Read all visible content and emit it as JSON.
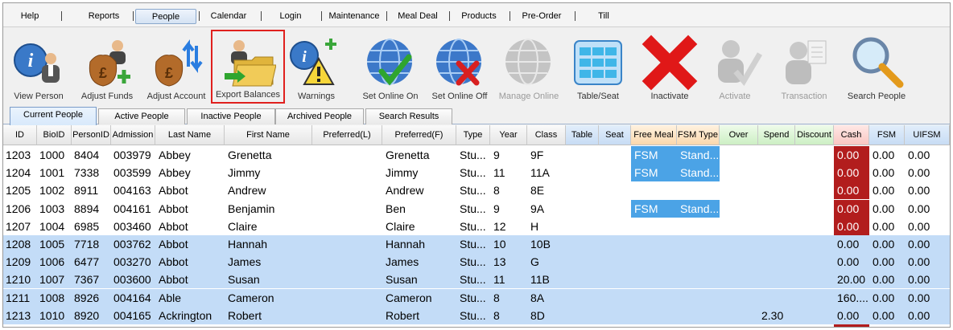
{
  "menu": [
    {
      "label": "Help"
    },
    {
      "label": "Reports"
    },
    {
      "label": "People",
      "active": true
    },
    {
      "label": "Calendar"
    },
    {
      "label": "Login"
    },
    {
      "label": "Maintenance"
    },
    {
      "label": "Meal Deal"
    },
    {
      "label": "Products"
    },
    {
      "label": "Pre-Order"
    },
    {
      "label": "Till"
    }
  ],
  "toolbar": [
    {
      "label": "View Person",
      "icon": "view-person-icon"
    },
    {
      "label": "Adjust Funds",
      "icon": "adjust-funds-icon"
    },
    {
      "label": "Adjust Account",
      "icon": "adjust-account-icon"
    },
    {
      "label": "Export Balances",
      "icon": "export-balances-icon",
      "selected": true
    },
    {
      "label": "Warnings",
      "icon": "warnings-icon"
    },
    {
      "label": "Set Online On",
      "icon": "set-online-on-icon"
    },
    {
      "label": "Set Online Off",
      "icon": "set-online-off-icon"
    },
    {
      "label": "Manage Online",
      "icon": "manage-online-icon",
      "disabled": true
    },
    {
      "label": "Table/Seat",
      "icon": "table-seat-icon"
    },
    {
      "label": "Inactivate",
      "icon": "inactivate-icon"
    },
    {
      "label": "Activate",
      "icon": "activate-icon",
      "disabled": true
    },
    {
      "label": "Transaction",
      "icon": "transaction-icon",
      "disabled": true
    },
    {
      "label": "Search People",
      "icon": "search-people-icon"
    }
  ],
  "tabs": [
    {
      "label": "Current People",
      "active": true
    },
    {
      "label": "Active People"
    },
    {
      "label": "Inactive People"
    },
    {
      "label": "Archived People"
    },
    {
      "label": "Search Results"
    }
  ],
  "columns": [
    "ID",
    "BioID",
    "PersonID",
    "Admission",
    "Last Name",
    "First Name",
    "Preferred(L)",
    "Preferred(F)",
    "Type",
    "Year",
    "Class",
    "Table",
    "Seat",
    "Free Meal",
    "FSM Type",
    "Over",
    "Spend",
    "Discount",
    "Cash",
    "FSM",
    "UIFSM"
  ],
  "rows": [
    [
      "1203",
      "1000",
      "8404",
      "003979",
      "Abbey",
      "Grenetta",
      "",
      "Grenetta",
      "Stu...",
      "9",
      "9F",
      "",
      "",
      "FSM",
      "Stand...",
      "",
      "",
      "",
      "0.00",
      "0.00",
      "0.00"
    ],
    [
      "1204",
      "1001",
      "7338",
      "003599",
      "Abbey",
      "Jimmy",
      "",
      "Jimmy",
      "Stu...",
      "11",
      "11A",
      "",
      "",
      "FSM",
      "Stand...",
      "",
      "",
      "",
      "0.00",
      "0.00",
      "0.00"
    ],
    [
      "1205",
      "1002",
      "8911",
      "004163",
      "Abbot",
      "Andrew",
      "",
      "Andrew",
      "Stu...",
      "8",
      "8E",
      "",
      "",
      "",
      "",
      "",
      "",
      "",
      "0.00",
      "0.00",
      "0.00"
    ],
    [
      "1206",
      "1003",
      "8894",
      "004161",
      "Abbot",
      "Benjamin",
      "",
      "Ben",
      "Stu...",
      "9",
      "9A",
      "",
      "",
      "FSM",
      "Stand...",
      "",
      "",
      "",
      "0.00",
      "0.00",
      "0.00"
    ],
    [
      "1207",
      "1004",
      "6985",
      "003460",
      "Abbot",
      "Claire",
      "",
      "Claire",
      "Stu...",
      "12",
      "H",
      "",
      "",
      "",
      "",
      "",
      "",
      "",
      "0.00",
      "0.00",
      "0.00"
    ],
    [
      "1208",
      "1005",
      "7718",
      "003762",
      "Abbot",
      "Hannah",
      "",
      "Hannah",
      "Stu...",
      "10",
      "10B",
      "",
      "",
      "",
      "",
      "",
      "",
      "",
      "0.00",
      "0.00",
      "0.00"
    ],
    [
      "1209",
      "1006",
      "6477",
      "003270",
      "Abbot",
      "James",
      "",
      "James",
      "Stu...",
      "13",
      "G",
      "",
      "",
      "",
      "",
      "",
      "",
      "",
      "0.00",
      "0.00",
      "0.00"
    ],
    [
      "1210",
      "1007",
      "7367",
      "003600",
      "Abbot",
      "Susan",
      "",
      "Susan",
      "Stu...",
      "11",
      "11B",
      "",
      "",
      "",
      "",
      "",
      "",
      "",
      "20.00",
      "0.00",
      "0.00"
    ],
    [
      "1211",
      "1008",
      "8926",
      "004164",
      "Able",
      "Cameron",
      "",
      "Cameron",
      "Stu...",
      "8",
      "8A",
      "",
      "",
      "",
      "",
      "",
      "",
      "",
      "160....",
      "0.00",
      "0.00"
    ],
    [
      "1213",
      "1010",
      "8920",
      "004165",
      "Ackrington",
      "Robert",
      "",
      "Robert",
      "Stu...",
      "8",
      "8D",
      "",
      "",
      "",
      "",
      "",
      "2.30",
      "",
      "0.00",
      "0.00",
      "0.00"
    ]
  ],
  "selected_rows": [
    5,
    6,
    7,
    8,
    9
  ],
  "red_cash_rows": [
    0,
    1,
    2,
    3,
    4
  ],
  "colors": {
    "fsm_cell": "#4ba3e6",
    "cash_negative": "#b21d1d",
    "selected_row": "#c3dcf7",
    "export_highlight": "#e0201e"
  }
}
